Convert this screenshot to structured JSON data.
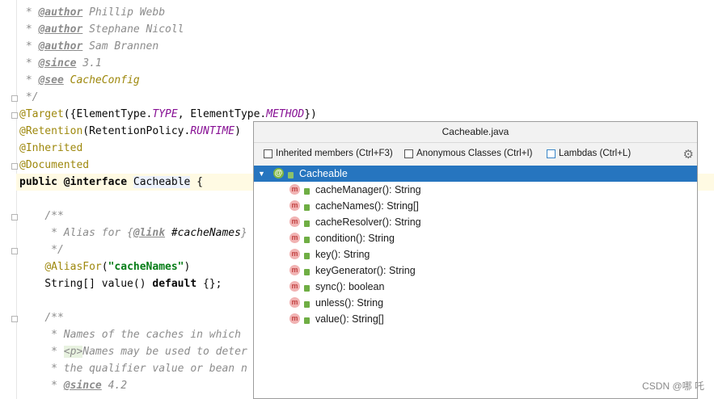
{
  "editor": {
    "lines": [
      {
        "id": "l1",
        "text": " * @author Phillip Webb"
      },
      {
        "id": "l2",
        "text": " * @author Stephane Nicoll"
      },
      {
        "id": "l3",
        "text": " * @author Sam Brannen"
      },
      {
        "id": "l4",
        "text": " * @since 3.1"
      },
      {
        "id": "l5",
        "text": " * @see CacheConfig"
      },
      {
        "id": "l6",
        "text": " */"
      }
    ]
  },
  "code": {
    "target": "@Target({ElementType.TYPE, ElementType.METHOD})",
    "retention": "@Retention(RetentionPolicy.RUNTIME)",
    "inherited": "@Inherited",
    "documented": "@Documented",
    "decl": "public @interface Cacheable {",
    "c1": "/**",
    "c2": " * Alias for {@link #cacheNames}",
    "c3": " */",
    "aliasfor": "@AliasFor(\"cacheNames\")",
    "value": "String[] value() default {};",
    "c4": "/**",
    "c5": " * Names of the caches in which",
    "c6": " * <p>Names may be used to deter",
    "c7": " * the qualifier value or bean n",
    "c8": " * @since 4.2"
  },
  "popup": {
    "title": "Cacheable.java",
    "options": [
      {
        "label": "Inherited members (Ctrl+F3)"
      },
      {
        "label": "Anonymous Classes (Ctrl+I)"
      },
      {
        "label": "Lambdas (Ctrl+L)"
      }
    ],
    "root": "Cacheable",
    "members": [
      "cacheManager(): String",
      "cacheNames(): String[]",
      "cacheResolver(): String",
      "condition(): String",
      "key(): String",
      "keyGenerator(): String",
      "sync(): boolean",
      "unless(): String",
      "value(): String[]"
    ]
  },
  "watermark": "CSDN @哪 吒",
  "colors": {
    "selection": "#2675bf",
    "annotation": "#9e880d",
    "keyword": "#0033b3"
  }
}
